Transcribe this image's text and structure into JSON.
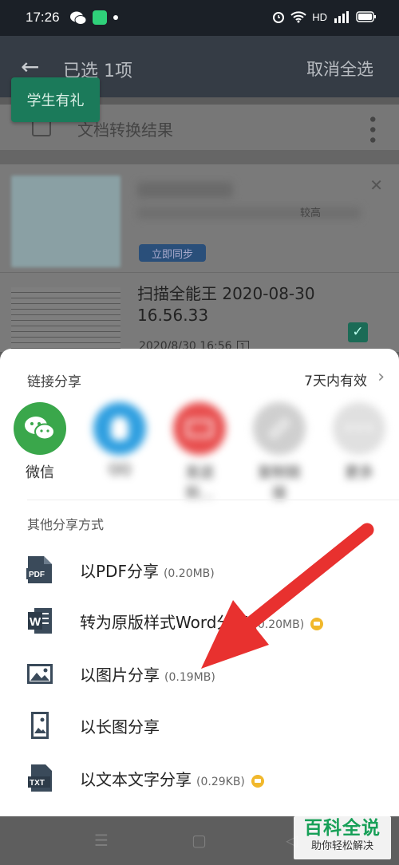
{
  "status_bar": {
    "time": "17:26",
    "network": "HD"
  },
  "app_bar": {
    "title": "已选 1项",
    "cancel_all": "取消全选"
  },
  "promo_badge": "学生有礼",
  "section": {
    "label": "文档转换结果"
  },
  "ad_card": {
    "subtitle_tail": "较高",
    "sync_button": "立即同步"
  },
  "document": {
    "name": "扫描全能王 2020-08-30 16.56.33",
    "date": "2020/8/30 16:56",
    "pages": "1"
  },
  "sheet": {
    "link_share_label": "链接分享",
    "validity": "7天内有效",
    "share_targets": [
      {
        "label": "微信",
        "color": "#3aa74b",
        "icon": "wechat-icon"
      },
      {
        "label": "QQ",
        "color": "#2f9fe0",
        "icon": "qq-icon"
      },
      {
        "label": "发送到…",
        "color": "#e84f4f",
        "icon": "tv-icon"
      },
      {
        "label": "复制链接",
        "color": "#bbbbbb",
        "icon": "link-icon"
      },
      {
        "label": "更多",
        "color": "#d9d9d9",
        "icon": "more-icon"
      }
    ],
    "other_label": "其他分享方式",
    "options": [
      {
        "label": "以PDF分享",
        "size": "(0.20MB)",
        "icon": "pdf-icon"
      },
      {
        "label": "转为原版样式Word分享",
        "size": "(0.20MB)",
        "icon": "word-icon",
        "vip": true
      },
      {
        "label": "以图片分享",
        "size": "(0.19MB)",
        "icon": "image-icon"
      },
      {
        "label": "以长图分享",
        "size": "",
        "icon": "long-image-icon"
      },
      {
        "label": "以文本文字分享",
        "size": "(0.29KB)",
        "icon": "txt-icon",
        "vip": true
      }
    ]
  },
  "watermark": {
    "title": "百科全说",
    "subtitle": "助你轻松解决"
  },
  "colors": {
    "accent_green": "#1b7a5a",
    "arrow_red": "#e8312f",
    "wechat_green": "#3aa74b"
  }
}
